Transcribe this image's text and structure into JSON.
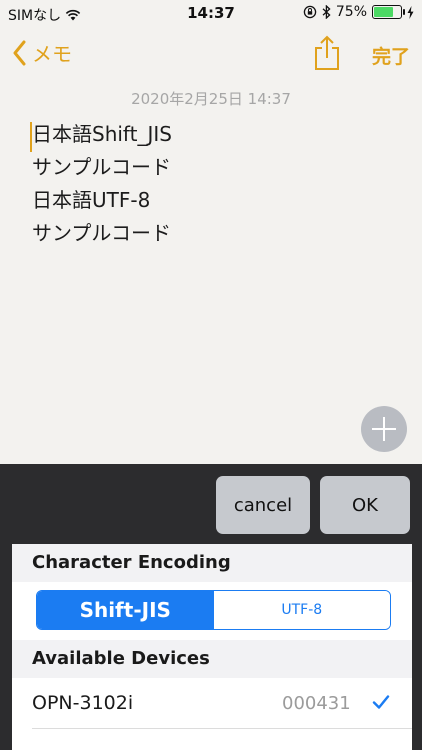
{
  "status_bar": {
    "carrier": "SIMなし",
    "time": "14:37",
    "battery_percent": "75%",
    "battery_level": 0.75,
    "icons": [
      "wifi-icon",
      "rotation-lock-icon",
      "bluetooth-icon",
      "battery-icon",
      "charging-icon"
    ]
  },
  "nav": {
    "back_label": "メモ",
    "done_label": "完了",
    "accent_color": "#e0a21d"
  },
  "note": {
    "date": "2020年2月25日 14:37",
    "lines": [
      "日本語Shift_JIS",
      "サンプルコード",
      "日本語UTF-8",
      "サンプルコード"
    ]
  },
  "sheet": {
    "cancel_label": "cancel",
    "ok_label": "OK",
    "encoding_header": "Character Encoding",
    "encoding_options": [
      "Shift-JIS",
      "UTF-8"
    ],
    "selected_encoding": "Shift-JIS",
    "devices_header": "Available Devices",
    "devices": [
      {
        "name": "OPN-3102i",
        "id": "000431",
        "selected": true
      }
    ],
    "accent_color": "#1b7cf2"
  }
}
